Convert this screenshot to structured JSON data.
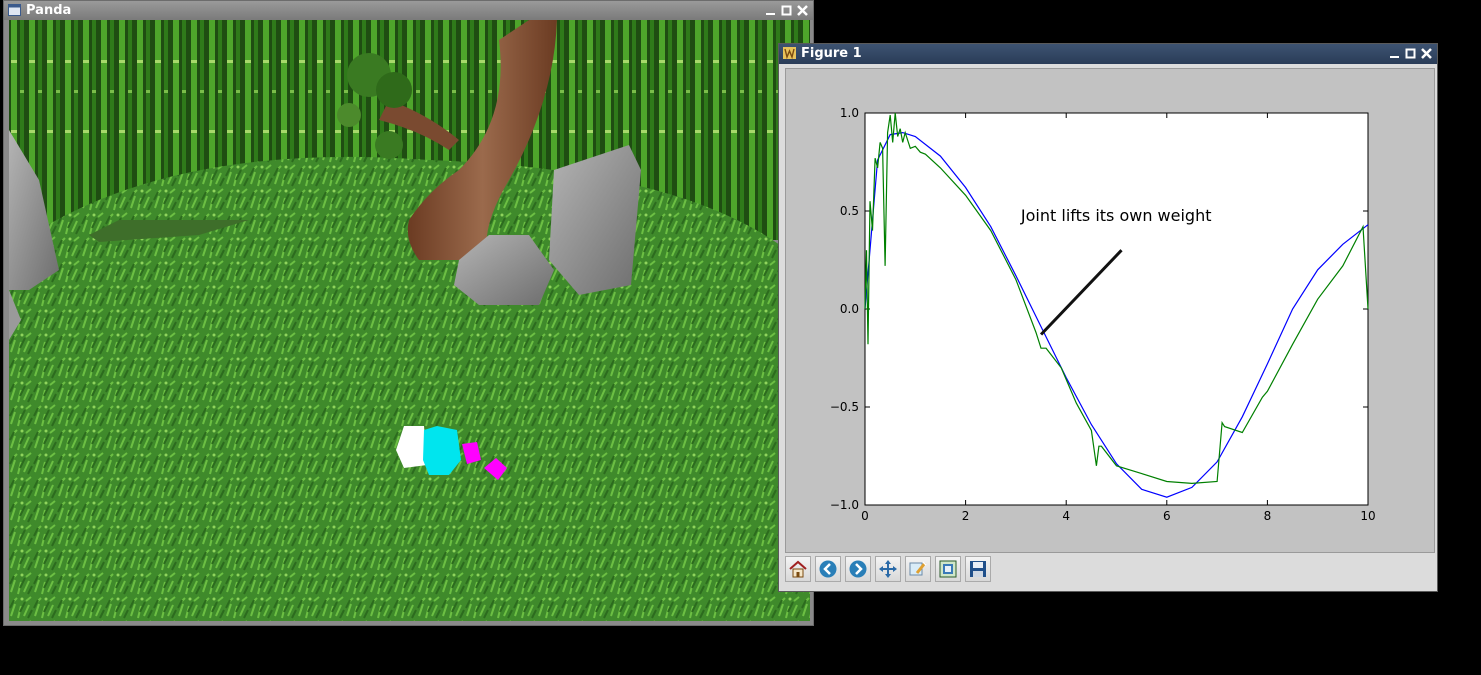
{
  "panda_window": {
    "title": "Panda",
    "title_icon": "window-icon",
    "controls": [
      "minimize-icon",
      "maximize-icon",
      "close-icon"
    ]
  },
  "figure_window": {
    "title": "Figure 1",
    "title_icon": "matplotlib-icon",
    "controls": [
      "minimize-icon",
      "maximize-icon",
      "close-icon"
    ],
    "toolbar": [
      {
        "name": "home-icon",
        "label": "Home"
      },
      {
        "name": "back-icon",
        "label": "Back"
      },
      {
        "name": "forward-icon",
        "label": "Forward"
      },
      {
        "name": "pan-icon",
        "label": "Pan"
      },
      {
        "name": "zoom-icon",
        "label": "Zoom"
      },
      {
        "name": "subplots-icon",
        "label": "Subplots"
      },
      {
        "name": "save-icon",
        "label": "Save"
      }
    ]
  },
  "chart_data": {
    "type": "line",
    "title": "",
    "xlabel": "",
    "ylabel": "",
    "xlim": [
      0,
      10
    ],
    "ylim": [
      -1.0,
      1.0
    ],
    "xticks": [
      "0",
      "2",
      "4",
      "6",
      "8",
      "10"
    ],
    "yticks": [
      "1.0",
      "0.5",
      "0.0",
      "−0.5",
      "−1.0"
    ],
    "grid": false,
    "annotation": {
      "text": "Joint lifts its own weight",
      "text_xy": [
        3.1,
        0.45
      ],
      "arrow_from": [
        5.1,
        0.3
      ],
      "arrow_to": [
        3.5,
        -0.13
      ]
    },
    "series": [
      {
        "color": "#0000ff",
        "x": [
          0,
          0.25,
          0.5,
          0.75,
          1,
          1.5,
          2,
          2.5,
          3,
          3.5,
          4,
          4.5,
          5,
          5.5,
          6,
          6.5,
          7,
          7.5,
          8,
          8.5,
          9,
          9.5,
          10
        ],
        "y": [
          0,
          0.76,
          0.89,
          0.9,
          0.88,
          0.78,
          0.62,
          0.42,
          0.17,
          -0.09,
          -0.35,
          -0.59,
          -0.79,
          -0.92,
          -0.96,
          -0.91,
          -0.78,
          -0.55,
          -0.28,
          0.0,
          0.2,
          0.33,
          0.43
        ]
      },
      {
        "color": "#008000",
        "x": [
          0,
          0.03,
          0.06,
          0.1,
          0.15,
          0.2,
          0.25,
          0.3,
          0.35,
          0.4,
          0.45,
          0.5,
          0.55,
          0.6,
          0.65,
          0.7,
          0.75,
          0.8,
          0.9,
          1.0,
          1.1,
          1.2,
          1.5,
          2.0,
          2.5,
          3.0,
          3.4,
          3.5,
          3.6,
          3.9,
          4.2,
          4.5,
          4.6,
          4.65,
          4.7,
          5.0,
          5.5,
          6.0,
          6.5,
          7.0,
          7.1,
          7.15,
          7.5,
          7.9,
          8.0,
          8.5,
          9.0,
          9.5,
          9.9,
          10.0
        ],
        "y": [
          0.0,
          0.3,
          -0.18,
          0.55,
          0.4,
          0.77,
          0.72,
          0.85,
          0.82,
          0.22,
          0.9,
          0.99,
          0.85,
          1.0,
          0.88,
          0.92,
          0.85,
          0.9,
          0.82,
          0.83,
          0.8,
          0.79,
          0.72,
          0.58,
          0.4,
          0.15,
          -0.12,
          -0.2,
          -0.2,
          -0.3,
          -0.48,
          -0.62,
          -0.8,
          -0.7,
          -0.7,
          -0.8,
          -0.84,
          -0.88,
          -0.89,
          -0.88,
          -0.58,
          -0.6,
          -0.63,
          -0.45,
          -0.42,
          -0.18,
          0.05,
          0.22,
          0.42,
          0.0
        ]
      }
    ]
  }
}
